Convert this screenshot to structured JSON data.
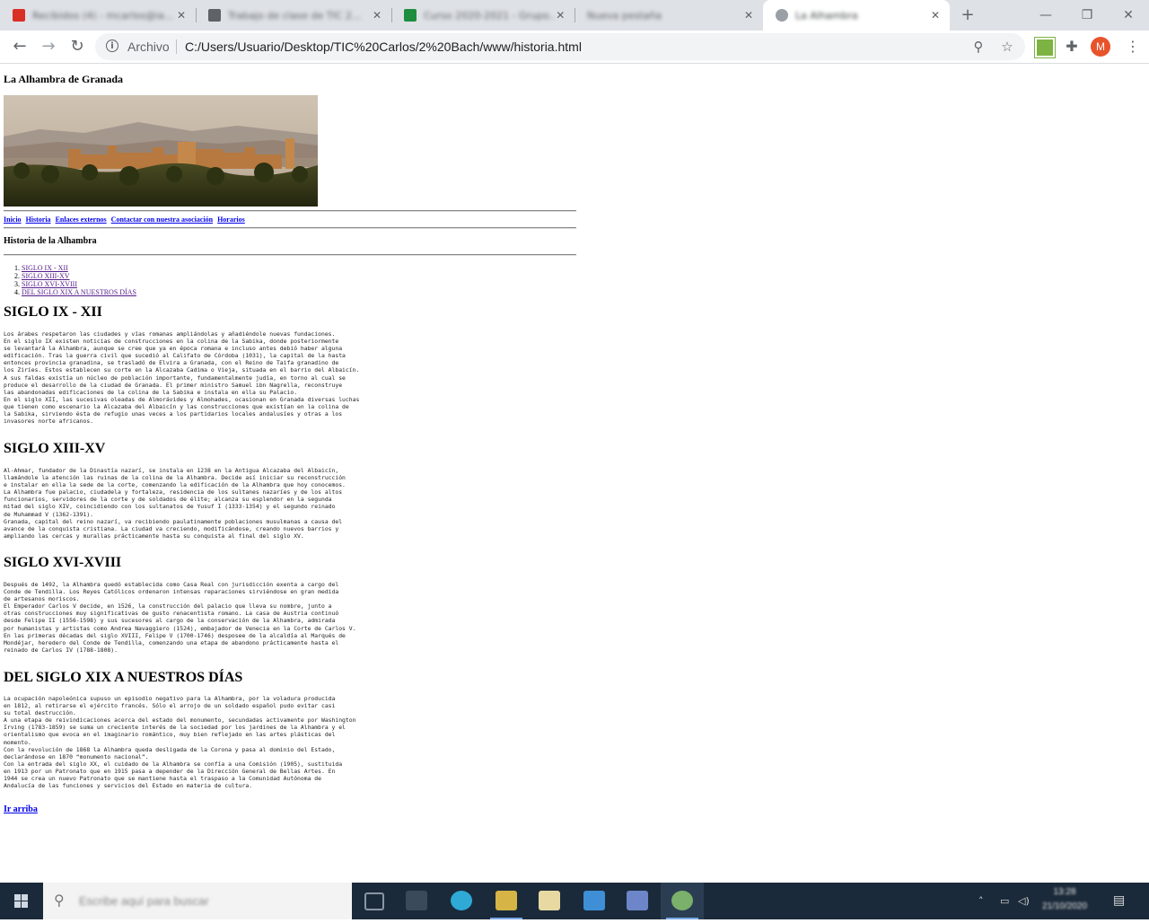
{
  "browser": {
    "tabs": [
      {
        "title": "Recibidos (4) - mcarlos@ia...",
        "favicon_color": "#d93025",
        "active": false
      },
      {
        "title": "Trabajo de clase de TIC 2...",
        "favicon_color": "#5f6368",
        "active": false
      },
      {
        "title": "Curso 2020-2021 - Grupo...",
        "favicon_color": "#1e8e3e",
        "active": false
      },
      {
        "title": "Nueva pestaña",
        "favicon_color": "#dee1e6",
        "active": false
      },
      {
        "title": "La Alhambra",
        "favicon_color": "#9aa0a6",
        "active": true
      }
    ],
    "new_tab_icon": "plus-icon",
    "window_controls": [
      "minimize-icon",
      "maximize-icon",
      "close-icon"
    ],
    "address": {
      "scheme_label": "Archivo",
      "url": "C:/Users/Usuario/Desktop/TIC%20Carlos/2%20Bach/www/historia.html"
    },
    "profile_initial": "M",
    "profile_color": "#e8532b"
  },
  "page": {
    "title": "La Alhambra de Granada",
    "nav": [
      "Inicio",
      "Historia",
      "Enlaces externos",
      "Contactar con nuestra asociación",
      "Horarios"
    ],
    "section_heading": "Historia de la Alhambra",
    "toc": [
      "SIGLO IX - XII",
      "SIGLO XIII-XV",
      "SIGLO XVI-XVIII",
      "DEL SIGLO XIX A NUESTROS DÍAS"
    ],
    "sections": [
      {
        "heading": "SIGLO IX - XII",
        "text": "Los árabes respetaron las ciudades y vías romanas ampliándolas y añadiéndole nuevas fundaciones.\nEn el siglo IX existen noticias de construcciones en la colina de la Sabika, donde posteriormente\nse levantará la Alhambra, aunque se cree que ya en época romana e incluso antes debió haber alguna\nedificación. Tras la guerra civil que sucedió al Califato de Córdoba (1031), la capital de la hasta\nentonces provincia granadina, se trasladó de Elvira a Granada, con el Reino de Taifa granadino de\nlos Ziríes. Estos establecen su corte en la Alcazaba Cadima o Vieja, situada en el barrio del Albaicín.\nA sus faldas existía un núcleo de población importante, fundamentalmente judía, en torno al cual se\nproduce el desarrollo de la ciudad de Granada. El primer ministro Samuel ibn Nagrella, reconstruye\nlas abandonadas edificaciones de la colina de la Sabika e instala en ella su Palacio.\nEn el siglo XII, las sucesivas oleadas de Almorávides y Almohades, ocasionan en Granada diversas luchas\nque tienen como escenario la Alcazaba del Albaicín y las construcciones que existían en la colina de\nla Sabika, sirviendo ésta de refugio unas veces a los partidarios locales andalusíes y otras a los\ninvasores norte africanos."
      },
      {
        "heading": "SIGLO XIII-XV",
        "text": "Al-Ahmar, fundador de la Dinastía nazarí, se instala en 1238 en la Antigua Alcazaba del Albaicín,\nllamándole la atención las ruinas de la colina de la Alhambra. Decide así iniciar su reconstrucción\ne instalar en ella la sede de la corte, comenzando la edificación de la Alhambra que hoy conocemos.\nLa Alhambra fue palacio, ciudadela y fortaleza, residencia de los sultanes nazaríes y de los altos\nfuncionarios, servidores de la corte y de soldados de élite; alcanza su esplendor en la segunda\nmitad del siglo XIV, coincidiendo con los sultanatos de Yusuf I (1333-1354) y el segundo reinado\nde Muhammad V (1362-1391).\nGranada, capital del reino nazarí, va recibiendo paulatinamente poblaciones musulmanas a causa del\navance de la conquista cristiana. La ciudad va creciendo, modificándose, creando nuevos barrios y\nampliando las cercas y murallas prácticamente hasta su conquista al final del siglo XV."
      },
      {
        "heading": "SIGLO XVI-XVIII",
        "text": "Después de 1492, la Alhambra quedó establecida como Casa Real con jurisdicción exenta a cargo del\nConde de Tendilla. Los Reyes Católicos ordenaron intensas reparaciones sirviéndose en gran medida\nde artesanos moriscos.\nEl Emperador Carlos V decide, en 1526, la construcción del palacio que lleva su nombre, junto a\notras construcciones muy significativas de gusto renacentista romano. La casa de Austria continuó\ndesde Felipe II (1556-1598) y sus sucesores al cargo de la conservación de la Alhambra, admirada\npor humanistas y artistas como Andrea Navaggiero (1524), embajador de Venecia en la Corte de Carlos V.\nEn las primeras décadas del siglo XVIII, Felipe V (1700-1746) desposee de la alcaldía al Marqués de\nMondéjar, heredero del Conde de Tendilla, comenzando una etapa de abandono prácticamente hasta el\nreinado de Carlos IV (1788-1808)."
      },
      {
        "heading": "DEL SIGLO XIX A NUESTROS DÍAS",
        "text": "La ocupación napoleónica supuso un episodio negativo para la Alhambra, por la voladura producida\nen 1812, al retirarse el ejército francés. Sólo el arrojo de un soldado español pudo evitar casi\nsu total destrucción.\nA una etapa de reivindicaciones acerca del estado del monumento, secundadas activamente por Washington\nIrving (1783-1859) se suma un creciente interés de la sociedad por los jardines de la Alhambra y el\norientalismo que evoca en el imaginario romántico, muy bien reflejado en las artes plásticas del\nmomento.\nCon la revolución de 1868 la Alhambra queda desligada de la Corona y pasa al dominio del Estado,\ndeclarándose en 1870 “monumento nacional”.\nCon la entrada del siglo XX, el cuidado de la Alhambra se confía a una Comisión (1905), sustituida\nen 1913 por un Patronato que en 1915 pasa a depender de la Dirección General de Bellas Artes. En\n1944 se crea un nuevo Patronato que se mantiene hasta el traspaso a la Comunidad Autónoma de\nAndalucía de las funciones y servicios del Estado en materia de cultura."
      }
    ],
    "back_to_top": "Ir arriba"
  },
  "taskbar": {
    "search_placeholder": "Escribe aquí para buscar",
    "apps": [
      {
        "name": "task-view",
        "color": "#2d3b4a"
      },
      {
        "name": "widgets",
        "color": "#2d3b4a"
      },
      {
        "name": "edge",
        "color": "#2fa9d6"
      },
      {
        "name": "explorer",
        "color": "#d6b445"
      },
      {
        "name": "files",
        "color": "#e8d9a3"
      },
      {
        "name": "mail",
        "color": "#3e8fd6"
      },
      {
        "name": "office",
        "color": "#6d86c9"
      },
      {
        "name": "chrome",
        "color": "#7ab06a"
      }
    ],
    "clock_time": "13:28",
    "clock_date": "21/10/2020"
  }
}
